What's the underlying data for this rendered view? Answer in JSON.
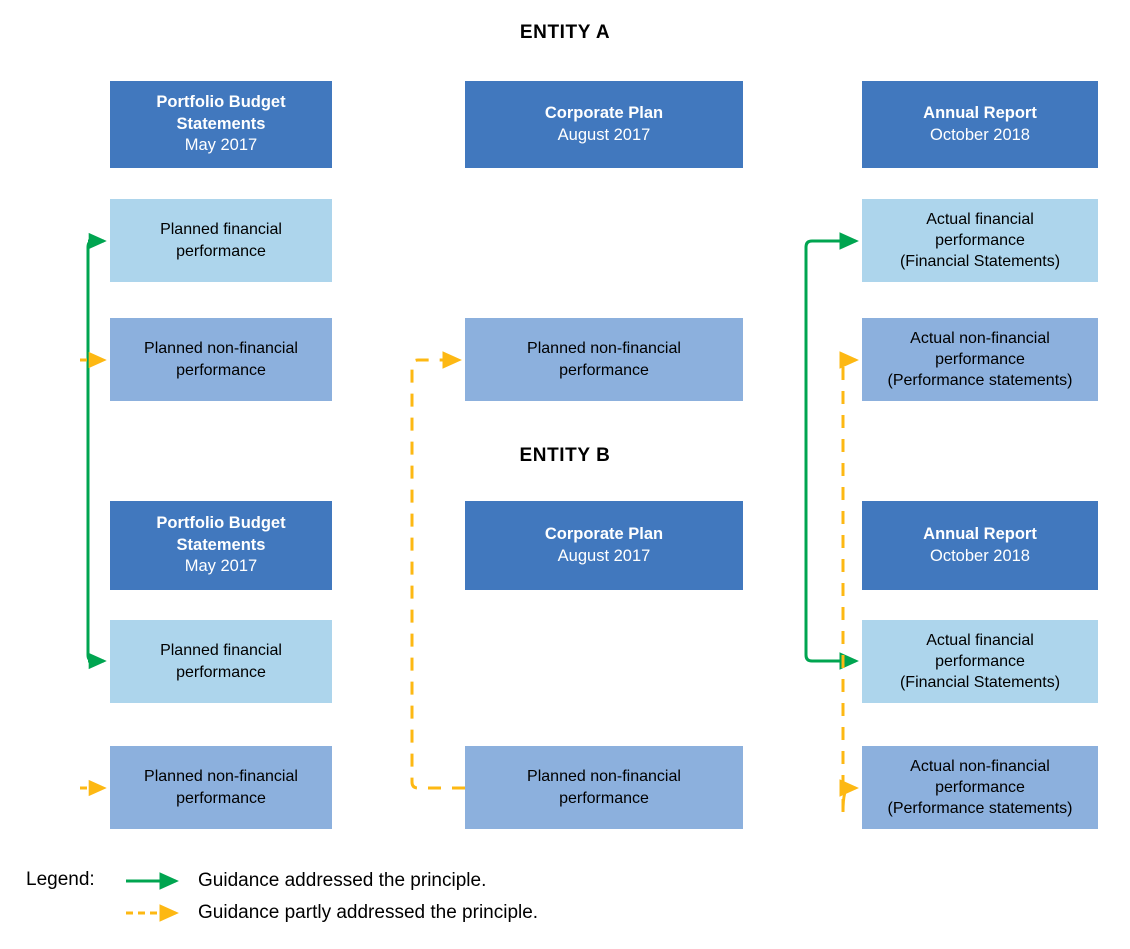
{
  "diagram": {
    "colors": {
      "header_box": "#4178be",
      "light_box": "#add5ec",
      "mid_box": "#8cb0dd",
      "green_arrow": "#00a550",
      "orange_arrow": "#fdb813",
      "text_dark": "#000000",
      "text_light": "#ffffff",
      "background": "#ffffff"
    },
    "entities": [
      {
        "title": "ENTITY A",
        "columns": [
          {
            "header": {
              "title": "Portfolio Budget Statements",
              "subtitle": "May 2017"
            },
            "items": [
              {
                "label": "Planned financial performance",
                "tone": "light"
              },
              {
                "label": "Planned non-financial performance",
                "tone": "mid"
              }
            ]
          },
          {
            "header": {
              "title": "Corporate Plan",
              "subtitle": "August 2017"
            },
            "items": [
              {
                "label": "Planned non-financial performance",
                "tone": "mid"
              }
            ]
          },
          {
            "header": {
              "title": "Annual Report",
              "subtitle": "October 2018"
            },
            "items": [
              {
                "label": "Actual financial performance (Financial Statements)",
                "tone": "light"
              },
              {
                "label": "Actual non-financial performance (Performance statements)",
                "tone": "mid"
              }
            ]
          }
        ]
      },
      {
        "title": "ENTITY B",
        "columns": [
          {
            "header": {
              "title": "Portfolio Budget Statements",
              "subtitle": "May 2017"
            },
            "items": [
              {
                "label": "Planned financial performance",
                "tone": "light"
              },
              {
                "label": "Planned non-financial performance",
                "tone": "mid"
              }
            ]
          },
          {
            "header": {
              "title": "Corporate Plan",
              "subtitle": "August 2017"
            },
            "items": [
              {
                "label": "Planned non-financial performance",
                "tone": "mid"
              }
            ]
          },
          {
            "header": {
              "title": "Annual Report",
              "subtitle": "October 2018"
            },
            "items": [
              {
                "label": "Actual financial performance (Financial Statements)",
                "tone": "light"
              },
              {
                "label": "Actual non-financial performance (Performance statements)",
                "tone": "mid"
              }
            ]
          }
        ]
      }
    ],
    "boxes": {
      "a_pbs_header_title": "Portfolio Budget",
      "a_pbs_header_title2": "Statements",
      "a_pbs_header_sub": "May 2017",
      "a_cp_header_title": "Corporate Plan",
      "a_cp_header_sub": "August 2017",
      "a_ar_header_title": "Annual Report",
      "a_ar_header_sub": "October 2018",
      "planned_financial_l1": "Planned financial",
      "planned_financial_l2": "performance",
      "planned_nonfinancial_l1": "Planned non-financial",
      "planned_nonfinancial_l2": "performance",
      "actual_financial_l1": "Actual financial",
      "actual_financial_l2": "performance",
      "actual_financial_l3": "(Financial Statements)",
      "actual_nonfinancial_l1": "Actual non-financial",
      "actual_nonfinancial_l2": "performance",
      "actual_nonfinancial_l3": "(Performance statements)",
      "b_pbs_header_title": "Portfolio Budget",
      "b_pbs_header_title2": "Statements",
      "b_pbs_header_sub": "May 2017",
      "b_cp_header_title": "Corporate Plan",
      "b_cp_header_sub": "August 2017",
      "b_ar_header_title": "Annual Report",
      "b_ar_header_sub": "October 2018"
    },
    "titles": {
      "entity_a": "ENTITY A",
      "entity_b": "ENTITY B"
    },
    "legend": {
      "label": "Legend:",
      "entries": [
        {
          "style": "solid-green-arrow",
          "text": "Guidance addressed the principle."
        },
        {
          "style": "dashed-orange-arrow",
          "text": "Guidance partly addressed the principle."
        }
      ],
      "entry_1_text": "Guidance addressed the principle.",
      "entry_2_text": "Guidance partly addressed the principle."
    }
  }
}
